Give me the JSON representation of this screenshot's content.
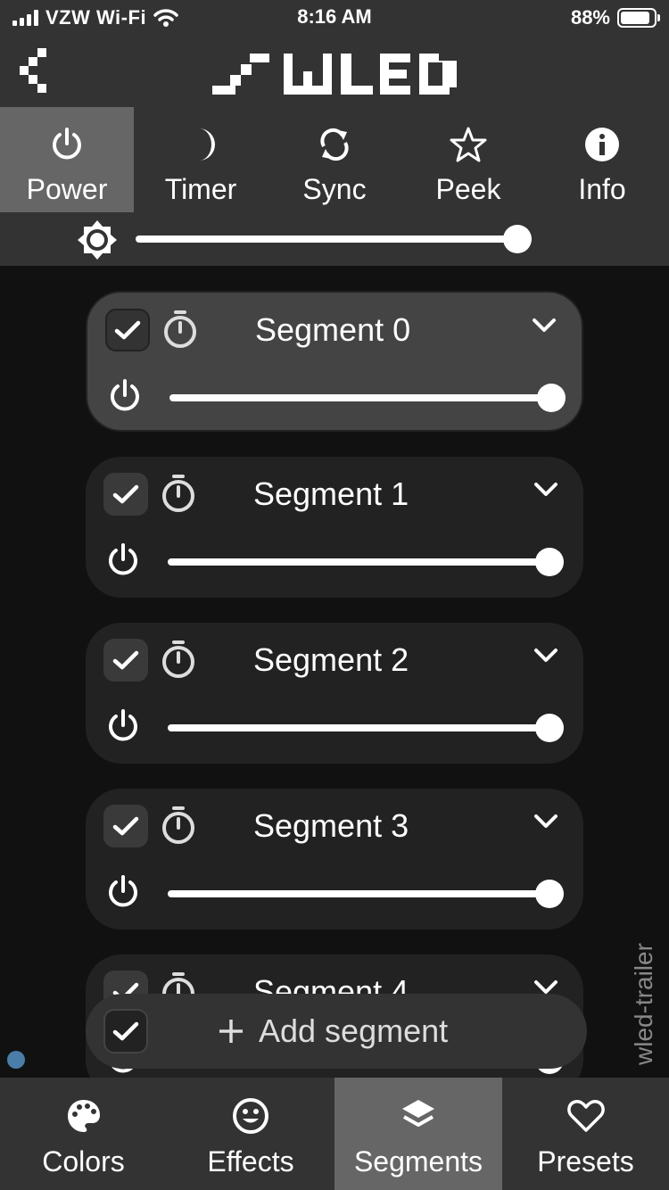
{
  "status_bar": {
    "carrier": "VZW Wi-Fi",
    "time": "8:16 AM",
    "battery": "88%"
  },
  "top_tabs": [
    {
      "label": "Power",
      "icon": "power-icon",
      "active": true
    },
    {
      "label": "Timer",
      "icon": "moon-icon",
      "active": false
    },
    {
      "label": "Sync",
      "icon": "sync-icon",
      "active": false
    },
    {
      "label": "Peek",
      "icon": "star-icon",
      "active": false
    },
    {
      "label": "Info",
      "icon": "info-icon",
      "active": false
    }
  ],
  "brightness": {
    "level": 1.0
  },
  "segments": [
    {
      "name": "Segment 0",
      "selected": true,
      "brightness": 1.0
    },
    {
      "name": "Segment 1",
      "selected": false,
      "brightness": 1.0
    },
    {
      "name": "Segment 2",
      "selected": false,
      "brightness": 1.0
    },
    {
      "name": "Segment 3",
      "selected": false,
      "brightness": 1.0
    },
    {
      "name": "Segment 4",
      "selected": false,
      "brightness": 1.0
    }
  ],
  "add_segment": {
    "label": "Add segment"
  },
  "side_label": "wled-trailer",
  "bottom_tabs": [
    {
      "label": "Colors",
      "icon": "palette-icon",
      "active": false
    },
    {
      "label": "Effects",
      "icon": "smiley-icon",
      "active": false
    },
    {
      "label": "Segments",
      "icon": "layers-icon",
      "active": true
    },
    {
      "label": "Presets",
      "icon": "heart-icon",
      "active": false
    }
  ],
  "colors": {
    "bar": "#333333",
    "active_tab": "#666666",
    "background": "#111111",
    "segment": "#222222",
    "segment_selected": "#444444",
    "dot": "#4a7ea8"
  }
}
